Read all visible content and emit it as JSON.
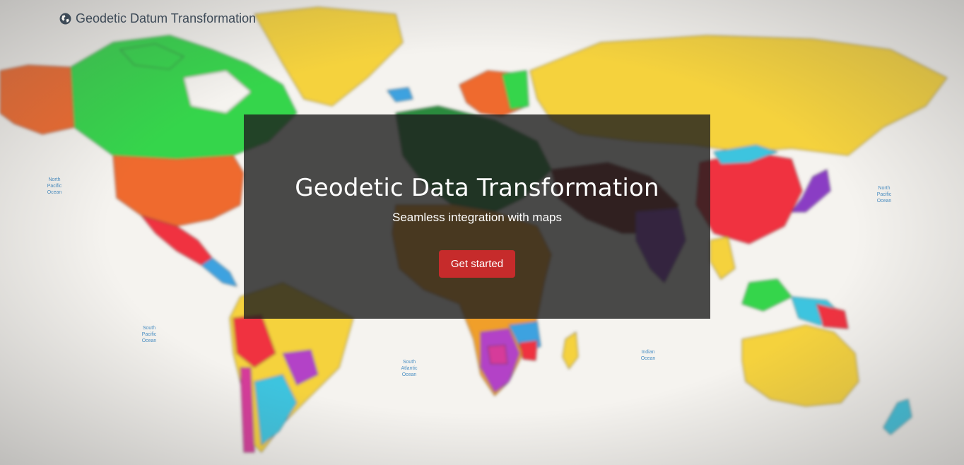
{
  "navbar": {
    "brand_icon": "globe-icon",
    "brand_label": "Geodetic Datum Transformation"
  },
  "hero": {
    "title": "Geodetic Data Transformation",
    "subtitle": "Seamless integration with maps",
    "cta_label": "Get started"
  },
  "map": {
    "ocean_labels": [
      "North\nPacific\nOcean",
      "South\nPacific\nOcean",
      "South\nAtlantic\nOcean",
      "Indian\nOcean",
      "North\nPacific\nOcean"
    ]
  },
  "colors": {
    "hero_overlay": "#1e1e1e",
    "cta_background": "#c62b2b",
    "brand_text": "#3d4a57",
    "ocean_label": "#4a8fc4"
  }
}
